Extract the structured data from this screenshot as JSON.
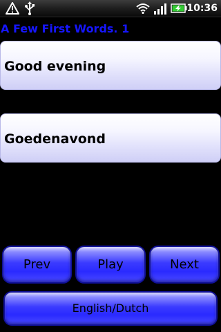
{
  "status_bar": {
    "time": "10:36",
    "icons": [
      "warning-icon",
      "usb-icon",
      "wifi-icon",
      "signal-icon",
      "battery-charging-icon"
    ]
  },
  "app": {
    "title": "A Few First Words. 1"
  },
  "phrase": {
    "english": "Good evening",
    "dutch": "Goedenavond"
  },
  "controls": {
    "prev_label": "Prev",
    "play_label": "Play",
    "next_label": "Next",
    "language_label": "English/Dutch"
  },
  "colors": {
    "title": "#1616ff",
    "button": "#2a2aff",
    "battery": "#33cc33"
  }
}
